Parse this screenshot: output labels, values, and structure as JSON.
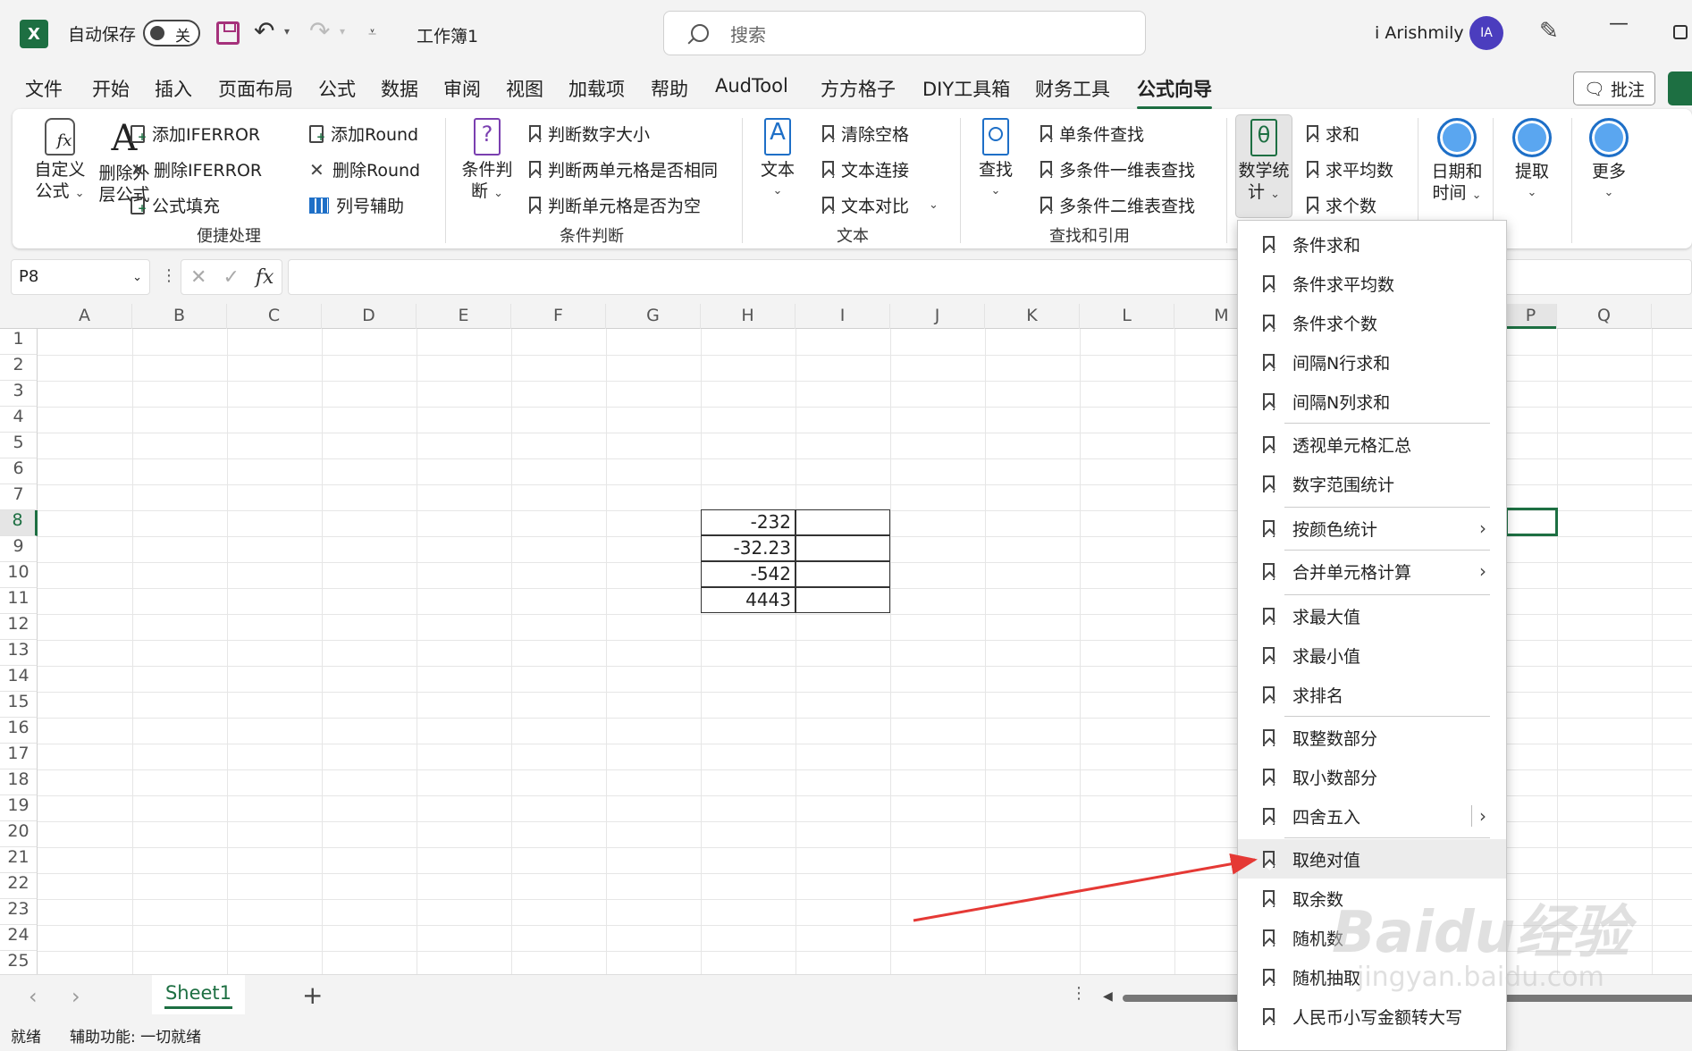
{
  "titlebar": {
    "app_logo": "X",
    "autosave_label": "自动保存",
    "autosave_state": "关",
    "book_title": "工作簿1",
    "search_placeholder": "搜索",
    "username": "i Arishmily",
    "avatar_initials": "IA",
    "icons": [
      "save-icon",
      "undo-icon",
      "redo-icon",
      "search-icon",
      "pen-icon",
      "minimize-icon",
      "restore-icon"
    ]
  },
  "menu": {
    "tabs": [
      "文件",
      "开始",
      "插入",
      "页面布局",
      "公式",
      "数据",
      "审阅",
      "视图",
      "加载项",
      "帮助",
      "AudTool",
      "方方格子",
      "DIY工具箱",
      "财务工具",
      "公式向导"
    ],
    "active_tab": "公式向导",
    "comments_label": "批注"
  },
  "ribbon": {
    "quick_process": {
      "custom_formula": "自定义公式",
      "custom_formula_l1": "自定义",
      "custom_formula_l2": "公式",
      "remove_outer_l1": "删除外",
      "remove_outer_l2": "层公式",
      "add_iferror": "添加IFERROR",
      "remove_iferror": "删除IFERROR",
      "formula_fill": "公式填充",
      "add_round": "添加Round",
      "remove_round": "删除Round",
      "col_helper": "列号辅助",
      "group_label": "便捷处理"
    },
    "condition": {
      "big_l1": "条件判",
      "big_l2": "断",
      "items": [
        "判断数字大小",
        "判断两单元格是否相同",
        "判断单元格是否为空"
      ],
      "group_label": "条件判断"
    },
    "text": {
      "big": "文本",
      "items": [
        "清除空格",
        "文本连接",
        "文本对比"
      ],
      "group_label": "文本"
    },
    "lookup": {
      "big": "查找",
      "items": [
        "单条件查找",
        "多条件一维表查找",
        "多条件二维表查找"
      ],
      "group_label": "查找和引用"
    },
    "math": {
      "big_l1": "数学统",
      "big_l2": "计",
      "items": [
        "求和",
        "求平均数",
        "求个数"
      ]
    },
    "datetime": {
      "l1": "日期和",
      "l2": "时间"
    },
    "extract": {
      "label": "提取"
    },
    "more": {
      "label": "更多"
    }
  },
  "formula_bar": {
    "name_box": "P8",
    "fx_label": "fx",
    "formula": ""
  },
  "grid": {
    "columns": [
      "A",
      "B",
      "C",
      "D",
      "E",
      "F",
      "G",
      "H",
      "I",
      "J",
      "K",
      "L",
      "M",
      "P",
      "Q"
    ],
    "rows": [
      "1",
      "2",
      "3",
      "4",
      "5",
      "6",
      "7",
      "8",
      "9",
      "10",
      "11",
      "12",
      "13",
      "14",
      "15",
      "16",
      "17",
      "18",
      "19",
      "20",
      "21",
      "22",
      "23",
      "24",
      "25"
    ],
    "active_row": "8",
    "cells_h": [
      "-232",
      "-32.23",
      "-542",
      "4443"
    ]
  },
  "sheets": {
    "tabs": [
      "Sheet1"
    ],
    "active": "Sheet1"
  },
  "status": {
    "ready": "就绪",
    "accessibility": "辅助功能: 一切就绪"
  },
  "dropdown": {
    "items": [
      {
        "label": "条件求和"
      },
      {
        "label": "条件求平均数"
      },
      {
        "label": "条件求个数"
      },
      {
        "label": "间隔N行求和"
      },
      {
        "label": "间隔N列求和"
      },
      {
        "label": "透视单元格汇总"
      },
      {
        "label": "数字范围统计"
      },
      {
        "label": "按颜色统计",
        "submenu": true
      },
      {
        "label": "合并单元格计算",
        "submenu": true
      },
      {
        "label": "求最大值"
      },
      {
        "label": "求最小值"
      },
      {
        "label": "求排名"
      },
      {
        "label": "取整数部分"
      },
      {
        "label": "取小数部分"
      },
      {
        "label": "四舍五入",
        "submenu": true
      },
      {
        "label": "取绝对值",
        "highlighted": true
      },
      {
        "label": "取余数"
      },
      {
        "label": "随机数"
      },
      {
        "label": "随机抽取"
      },
      {
        "label": "人民币小写金额转大写"
      }
    ]
  },
  "watermark": {
    "logo": "Baidu经验",
    "url": "jingyan.baidu.com"
  },
  "colors": {
    "excel_green": "#1d6f42",
    "arrow_red": "#e53935",
    "circle_blue": "#5aa6f0",
    "save_purple": "#a5317b"
  }
}
